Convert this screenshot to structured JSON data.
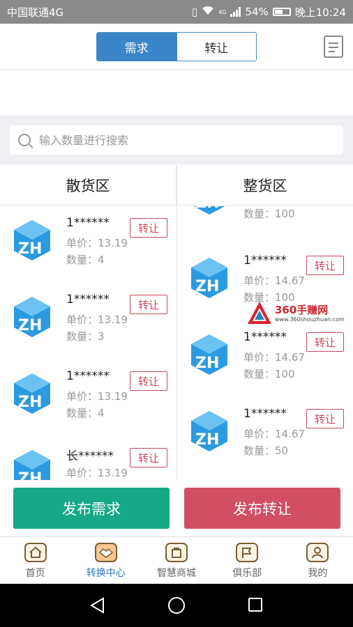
{
  "status_bar": {
    "carrier": "中国联通4G",
    "network": "4G",
    "battery": "54%",
    "time": "晚上10:24"
  },
  "header": {
    "tabs": [
      {
        "label": "需求",
        "active": true
      },
      {
        "label": "转让",
        "active": false
      }
    ],
    "doc_icon": "document-icon"
  },
  "search": {
    "placeholder": "输入数量进行搜索",
    "value": ""
  },
  "columns": {
    "left_title": "散货区",
    "right_title": "整货区"
  },
  "left_items": [
    {
      "name": "1******",
      "price": "单价：13.19",
      "qty": "数量：4",
      "tag": "转让"
    },
    {
      "name": "1******",
      "price": "单价：13.19",
      "qty": "数量：3",
      "tag": "转让"
    },
    {
      "name": "1******",
      "price": "单价：13.19",
      "qty": "数量：4",
      "tag": "转让"
    },
    {
      "name": "长******",
      "price": "单价：13.19",
      "qty": "",
      "tag": "转让"
    }
  ],
  "right_items": [
    {
      "name": "",
      "price": "",
      "qty": "数量：100",
      "tag": ""
    },
    {
      "name": "1******",
      "price": "单价：14.67",
      "qty": "数量：100",
      "tag": "转让"
    },
    {
      "name": "1******",
      "price": "单价：14.67",
      "qty": "数量：100",
      "tag": "转让"
    },
    {
      "name": "1******",
      "price": "单价：14.67",
      "qty": "数量：50",
      "tag": "转让"
    }
  ],
  "watermark": {
    "title": "360手赚网",
    "url": "www.360shouzhuan.com"
  },
  "actions": {
    "publish_demand": "发布需求",
    "publish_transfer": "发布转让"
  },
  "colors": {
    "accent": "#3a86c8",
    "green": "#17a987",
    "red": "#d24f63"
  },
  "tabbar": [
    {
      "label": "首页",
      "icon": "home-icon"
    },
    {
      "label": "转换中心",
      "icon": "handshake-icon",
      "active": true
    },
    {
      "label": "智慧商城",
      "icon": "shopping-bag-icon"
    },
    {
      "label": "俱乐部",
      "icon": "flag-icon"
    },
    {
      "label": "我的",
      "icon": "user-icon"
    }
  ]
}
